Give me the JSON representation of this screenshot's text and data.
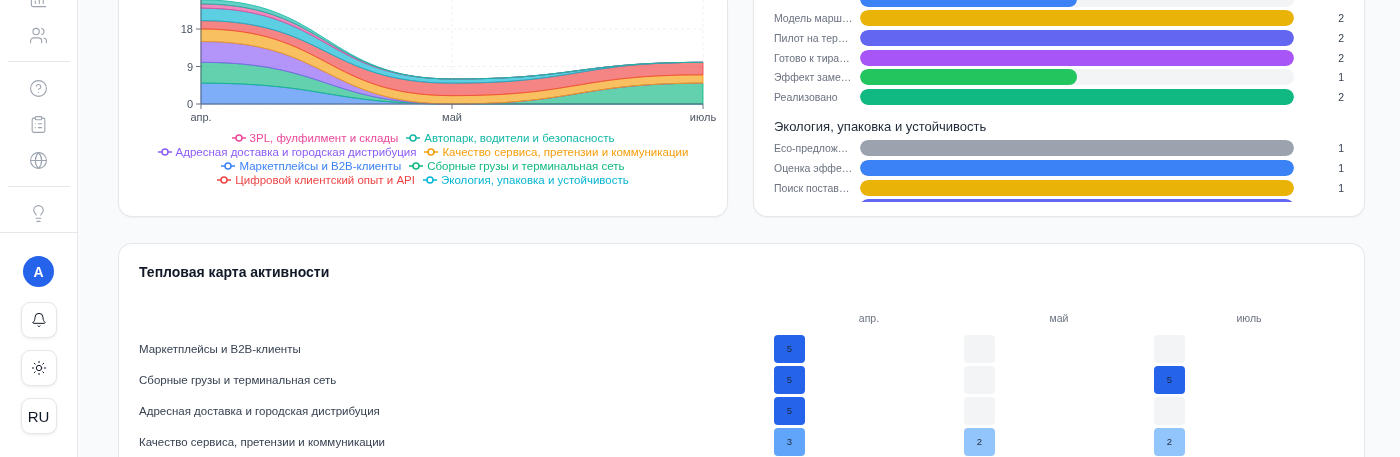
{
  "sidebar": {
    "nav_items": [
      {
        "kind": "chart"
      },
      {
        "kind": "users"
      },
      {
        "kind": "divider"
      },
      {
        "kind": "help"
      },
      {
        "kind": "clipboard"
      },
      {
        "kind": "globe"
      },
      {
        "kind": "divider"
      },
      {
        "kind": "bulb"
      }
    ],
    "avatar": "A",
    "buttons": [
      {
        "kind": "bell"
      },
      {
        "kind": "sun"
      },
      {
        "kind": "text",
        "label": "RU"
      }
    ]
  },
  "activity_chart": {
    "chart_data": {
      "type": "area",
      "stacked": true,
      "grid": true,
      "categories": [
        "апр.",
        "май",
        "июль"
      ],
      "ylim": [
        0,
        25
      ],
      "yticks": [
        0,
        9,
        18
      ],
      "series": [
        {
          "name": "Маркетплейсы и B2B-клиенты",
          "color": "#3b82f6",
          "values": [
            5,
            0,
            0
          ]
        },
        {
          "name": "Сборные грузы и терминальная сеть",
          "color": "#10b981",
          "values": [
            5,
            0,
            5
          ]
        },
        {
          "name": "Адресная доставка и городская дистрибуция",
          "color": "#8b5cf6",
          "values": [
            5,
            0,
            0
          ]
        },
        {
          "name": "Качество сервиса, претензии и коммуникации",
          "color": "#f59e0b",
          "values": [
            3,
            2,
            2
          ]
        },
        {
          "name": "Цифровой клиентский опыт и API",
          "color": "#ef4444",
          "values": [
            2,
            3,
            3
          ]
        },
        {
          "name": "Экология, упаковка и устойчивость",
          "color": "#06b6d4",
          "values": [
            3,
            1,
            0
          ]
        },
        {
          "name": "3PL, фулфилмент и склады",
          "color": "#ec4899",
          "values": [
            1,
            0,
            0
          ]
        },
        {
          "name": "Автопарк, водители и безопасность",
          "color": "#14b8a6",
          "values": [
            1,
            0,
            0
          ]
        }
      ]
    }
  },
  "status_groups": [
    {
      "rows": [
        {
          "level": 0.5,
          "color": "#3b82f6"
        },
        {
          "label": "Модель марш…",
          "count": "2",
          "level": 1,
          "color": "#eab308"
        },
        {
          "label": "Пилот на тер…",
          "count": "2",
          "level": 1,
          "color": "#6366f1"
        },
        {
          "label": "Готово к тира…",
          "count": "2",
          "level": 1,
          "color": "#a855f7"
        },
        {
          "label": "Эффект заме…",
          "count": "1",
          "level": 0.5,
          "color": "#22c55e"
        },
        {
          "label": "Реализовано",
          "count": "2",
          "level": 1,
          "color": "#10b981"
        }
      ]
    },
    {
      "title": "Экология, упаковка и устойчивость",
      "rows": [
        {
          "label": "Eco-предлож…",
          "count": "1",
          "level": 1,
          "color": "#9ca3af"
        },
        {
          "label": "Оценка эффе…",
          "count": "1",
          "level": 1,
          "color": "#3b82f6"
        },
        {
          "label": "Поиск постав…",
          "count": "1",
          "level": 1,
          "color": "#eab308"
        },
        {
          "level": 1,
          "color": "#6366f1"
        }
      ]
    }
  ],
  "heatmap": {
    "title": "Тепловая карта активности",
    "columns": [
      "апр.",
      "май",
      "июль"
    ],
    "rows": [
      {
        "label": "Маркетплейсы и B2B-клиенты",
        "cells": [
          {
            "value": "5",
            "color": "#2563eb"
          },
          {
            "color": "#f3f4f6"
          },
          {
            "color": "#f3f4f6"
          }
        ]
      },
      {
        "label": "Сборные грузы и терминальная сеть",
        "cells": [
          {
            "value": "5",
            "color": "#2563eb"
          },
          {
            "color": "#f3f4f6"
          },
          {
            "value": "5",
            "color": "#2563eb"
          }
        ]
      },
      {
        "label": "Адресная доставка и городская дистрибуция",
        "cells": [
          {
            "value": "5",
            "color": "#2563eb"
          },
          {
            "color": "#f3f4f6"
          },
          {
            "color": "#f3f4f6"
          }
        ]
      },
      {
        "label": "Качество сервиса, претензии и коммуникации",
        "cells": [
          {
            "value": "3",
            "color": "#60a5fa"
          },
          {
            "value": "2",
            "color": "#93c5fd"
          },
          {
            "value": "2",
            "color": "#93c5fd"
          }
        ]
      }
    ]
  }
}
